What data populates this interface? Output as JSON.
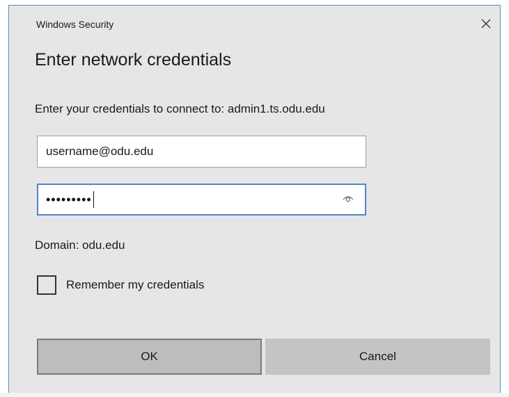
{
  "window": {
    "title": "Windows Security",
    "close_icon": "close-icon"
  },
  "dialog": {
    "heading": "Enter network credentials",
    "prompt": "Enter your credentials to connect to: admin1.ts.odu.edu"
  },
  "username_field": {
    "value": "username@odu.edu"
  },
  "password_field": {
    "masked_value": "•••••••••",
    "reveal_icon": "eye-icon"
  },
  "domain_text": "Domain: odu.edu",
  "remember": {
    "label": "Remember my credentials",
    "checked": false
  },
  "buttons": {
    "ok": "OK",
    "cancel": "Cancel"
  },
  "colors": {
    "dialog_background": "#e6e6e6",
    "focus_border": "#4f86c6",
    "window_border": "#5b8ac4"
  }
}
